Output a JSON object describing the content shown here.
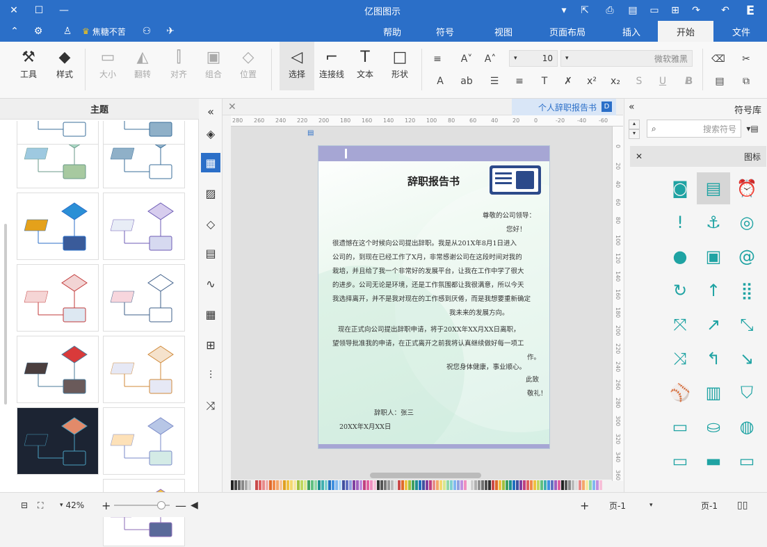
{
  "titlebar": {
    "title": "亿图图示",
    "window_controls": [
      "close-icon",
      "maximize-icon",
      "minimize-icon"
    ],
    "quick_actions": [
      "undo-icon",
      "redo-icon",
      "new-icon",
      "open-icon",
      "save-icon",
      "print-icon",
      "export-icon",
      "more-icon"
    ],
    "logo": "E"
  },
  "menubar": {
    "tabs": [
      "文件",
      "开始",
      "插入",
      "页面布局",
      "视图",
      "符号",
      "帮助"
    ],
    "active_tab": "开始",
    "user_name": "焦糖不苦",
    "right_icons": [
      "share-icon",
      "shirt-icon",
      "settings-icon",
      "collapse-icon"
    ]
  },
  "ribbon": {
    "groups": {
      "clipboard": [
        "cut-icon",
        "copy-icon",
        "paste-icon",
        "format-painter-icon"
      ],
      "font": {
        "family": "微软雅黑",
        "size": "10",
        "buttons": [
          "B",
          "I",
          "U",
          "S",
          "x²",
          "x₂",
          "ab",
          "A"
        ]
      },
      "tools": [
        {
          "label": "形状",
          "icon": "□"
        },
        {
          "label": "文本",
          "icon": "T"
        },
        {
          "label": "连接线",
          "icon": "⌐"
        },
        {
          "label": "选择",
          "icon": "◁"
        },
        {
          "label": "位置",
          "icon": "◇"
        },
        {
          "label": "组合",
          "icon": "▣"
        },
        {
          "label": "对齐",
          "icon": "⫿"
        },
        {
          "label": "翻转",
          "icon": "◭"
        },
        {
          "label": "大小",
          "icon": "▭"
        },
        {
          "label": "样式",
          "icon": "◆"
        },
        {
          "label": "工具",
          "icon": "⚒"
        }
      ]
    }
  },
  "left_panel": {
    "header": "主题"
  },
  "document": {
    "tab_title": "个人辞职报告书",
    "ruler_labels": [
      "280",
      "260",
      "240",
      "220",
      "200",
      "180",
      "160",
      "140",
      "120",
      "100",
      "80",
      "60",
      "40",
      "20",
      "0",
      "-20",
      "-40",
      "-60"
    ],
    "vruler_labels": [
      "0",
      "20",
      "40",
      "60",
      "80",
      "100",
      "120",
      "140",
      "160",
      "180",
      "200",
      "220",
      "240",
      "260",
      "280",
      "300",
      "320",
      "340",
      "360"
    ],
    "page": {
      "title": "辞职报告书",
      "lines": [
        "尊敬的公司领导：",
        "您好！",
        "很遗憾在这个时候向公司提出辞职。我是从201X年8月1日进入",
        "公司的，到现在已经工作了X月，非常感谢公司在这段时间对我的",
        "栽培，并且给了我一个非常好的发展平台，让我在工作中学了很大",
        "的进步。公司无论是环境，还是工作氛围都让我很满意，所以今天",
        "我选择离开，并不是我对现在的工作感到厌倦，而是我想要重新确定",
        "我未来的发展方向。",
        "现在正式向公司提出辞职申请，将于20XX年XX月XX日离职，",
        "望领导批准我的申请，在正式离开之前我将认真继续做好每一项工",
        "作。",
        "祝您身体健康，事业顺心。",
        "此致",
        "敬礼！"
      ],
      "signature": "辞职人：张三",
      "date": "20XX年X月XX日"
    }
  },
  "right_panel": {
    "title": "符号库",
    "search_placeholder": "搜索符号",
    "category": "图标",
    "symbols": [
      "alarm-clock-icon",
      "id-card-icon",
      "portrait-card-icon",
      "camera-lens-icon",
      "anchor-icon",
      "exclamation-icon",
      "rss-icon",
      "android-icon",
      "apple-icon",
      "grid-icon",
      "arrow-up-icon",
      "refresh-icon",
      "arrow-diagonal-icon",
      "trending-up-icon",
      "expand-icon",
      "arrow-down-right-icon",
      "return-icon",
      "compress-icon",
      "shopping-bag-icon",
      "bar-chart-icon",
      "baseball-icon",
      "basketball-icon",
      "bathtub-icon",
      "battery-icon",
      "battery-empty-icon",
      "battery-full-icon",
      "battery-low-icon"
    ]
  },
  "statusbar": {
    "page_label": "页-1",
    "page_tab": "页-1",
    "zoom": "42%"
  },
  "colors": {
    "brand": "#2b6fc8",
    "symbol": "#1fa3a3",
    "page_band": "#a6a6d4"
  }
}
